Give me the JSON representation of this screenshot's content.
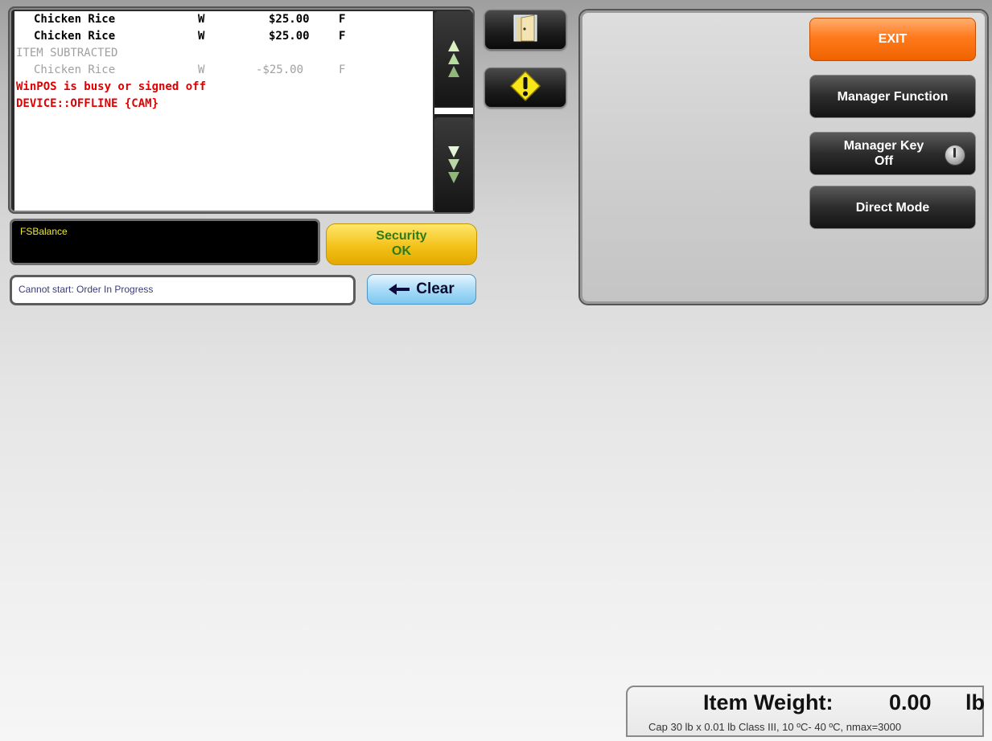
{
  "receipt": {
    "lines": [
      {
        "name": "Chicken Rice",
        "flag": "W",
        "price": "$25.00",
        "tax": "F",
        "state": "normal"
      },
      {
        "name": "Chicken Rice",
        "flag": "W",
        "price": "$25.00",
        "tax": "F",
        "state": "normal"
      },
      {
        "text": "ITEM SUBTRACTED",
        "state": "subtracted"
      },
      {
        "name": "Chicken Rice",
        "flag": "W",
        "price": "-$25.00",
        "tax": "F",
        "state": "subtracted"
      },
      {
        "text": "WinPOS is busy or signed off",
        "state": "error"
      },
      {
        "text": "DEVICE::OFFLINE {CAM}",
        "state": "error"
      }
    ]
  },
  "icons": {
    "scroll_up": "triple-up-arrow-icon",
    "scroll_down": "triple-down-arrow-icon",
    "door": "door-icon",
    "warning": "warning-diamond-icon",
    "clear_arrow": "left-arrow-icon",
    "manager_key": "key-switch-icon"
  },
  "fs_balance_label": "FSBalance",
  "security": {
    "line1": "Security",
    "line2": "OK"
  },
  "status_message": "Cannot start: Order In Progress",
  "clear_label": "Clear",
  "right_panel": {
    "exit_label": "EXIT",
    "manager_function_label": "Manager Function",
    "manager_key_label": "Manager Key",
    "manager_key_state": "Off",
    "direct_mode_label": "Direct Mode"
  },
  "scale": {
    "label": "Item Weight:",
    "value": "0.00",
    "unit": "lb",
    "spec": "Cap 30 lb x 0.01 lb Class III, 10 ºC- 40 ºC, nmax=3000"
  },
  "colors": {
    "exit": "#ff7a1c",
    "security": "#f3c21a",
    "clear": "#7cc7ef",
    "error_text": "#e00000"
  }
}
